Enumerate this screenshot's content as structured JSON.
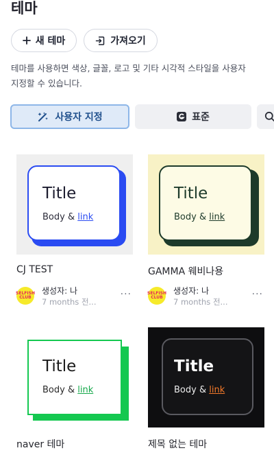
{
  "header": {
    "title": "테마"
  },
  "actions": {
    "new_label": "새 테마",
    "import_label": "가져오기"
  },
  "description": {
    "line1": "테마를 사용하면 색상, 글꼴, 로고 및 기타 시각적 스타일을 사용자",
    "line2": "지정할 수 있습니다."
  },
  "tabs": [
    {
      "label": "사용자 지정",
      "icon": "wand-sparkle-icon",
      "selected": true
    },
    {
      "label": "표준",
      "icon": "gamma-logo-icon",
      "selected": false
    },
    {
      "label": "",
      "icon": "search-icon",
      "selected": false
    }
  ],
  "preview_text": {
    "title": "Title",
    "body": "Body &",
    "link": "link"
  },
  "themes": [
    {
      "name": "CJ TEST",
      "creator": "생성자: 나",
      "time": "7 months 전...",
      "colors": {
        "background": "#efefef",
        "card": "#ffffff",
        "border": "#2a4bf2",
        "shadow": "#2a4bf2",
        "title": "#1b1b2e",
        "body": "#2c2c3a",
        "link": "#2a4bf2"
      }
    },
    {
      "name": "GAMMA 웨비나용",
      "creator": "생성자: 나",
      "time": "7 months 전...",
      "colors": {
        "background": "#f8f2c6",
        "card": "#fdfbe5",
        "border": "#1d3a2a",
        "shadow": "#1d3a2a",
        "title": "#1d3a2a",
        "body": "#1d3a2a",
        "link": "#1d3a2a"
      }
    },
    {
      "name": "naver 테마",
      "creator": "",
      "time": "",
      "colors": {
        "background": "#ffffff",
        "card": "#ffffff",
        "border": "#14c850",
        "shadow": "#14c850",
        "title": "#1b1b1b",
        "body": "#2a2a2a",
        "link": "#14a84a"
      }
    },
    {
      "name": "제목 없는 테마",
      "creator": "",
      "time": "",
      "colors": {
        "background": "#0e0e10",
        "card": "#141416",
        "border": "#5a5a60",
        "shadow": "none",
        "title": "#ffffff",
        "body": "#ececec",
        "link": "#f57a2a"
      }
    }
  ],
  "avatar_text": {
    "line1": "SELFISH",
    "line2": "CLUB"
  },
  "more_label": "..."
}
